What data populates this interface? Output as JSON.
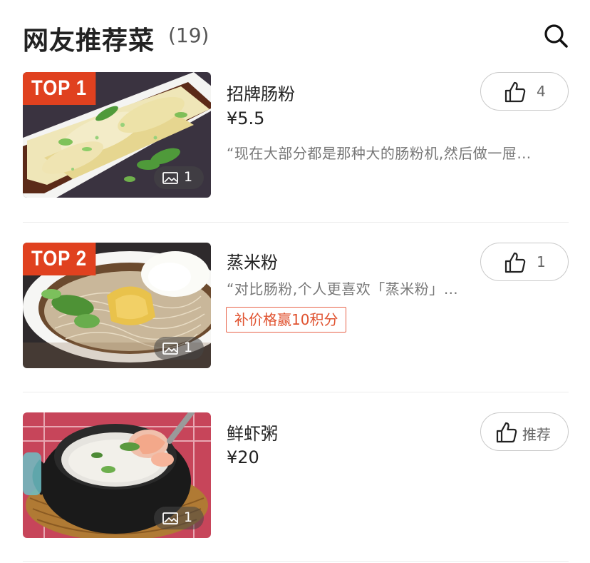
{
  "header": {
    "title": "网友推荐菜",
    "count": "(19)"
  },
  "dishes": [
    {
      "rank": "TOP 1",
      "name": "招牌肠粉",
      "price": "¥5.5",
      "review": "“现在大部分都是那种大的肠粉机,然后做一屉…",
      "photo_count": "1",
      "likes": "4",
      "icons": [
        "image-icon",
        "thumbs-up-icon"
      ]
    },
    {
      "rank": "TOP 2",
      "name": "蒸米粉",
      "review": "“对比肠粉,个人更喜欢「蒸米粉」…",
      "reward": "补价格赢10积分",
      "photo_count": "1",
      "likes": "1",
      "icons": [
        "image-icon",
        "thumbs-up-icon"
      ]
    },
    {
      "name": "鲜虾粥",
      "price": "¥20",
      "photo_count": "1",
      "recommend_label": "推荐",
      "icons": [
        "image-icon",
        "thumbs-up-icon"
      ]
    }
  ],
  "colors": {
    "rank_badge": "#e0411f",
    "reward_text": "#e0522f",
    "separator": "#ececec"
  }
}
